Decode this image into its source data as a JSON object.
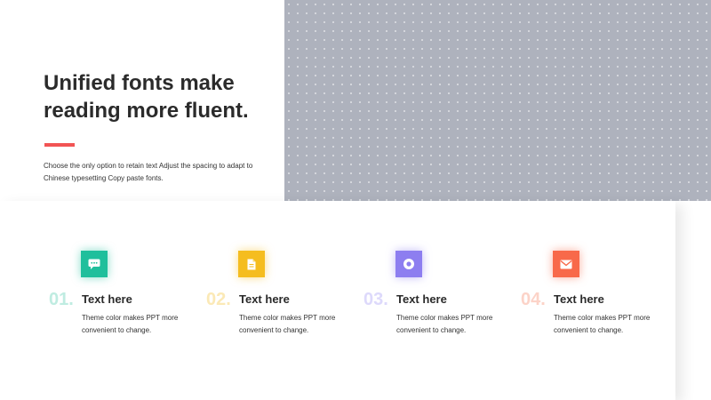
{
  "hero": {
    "title": "Unified fonts make\nreading more fluent.",
    "description": "Choose the only option to retain text Adjust the spacing to adapt to Chinese typesetting Copy paste fonts."
  },
  "features": [
    {
      "number": "01.",
      "title": "Text here",
      "description": "Theme color makes PPT more convenient to change.",
      "icon": "chat-bubble-icon",
      "color": "#1fbf9c"
    },
    {
      "number": "02.",
      "title": "Text here",
      "description": "Theme color makes PPT more convenient to change.",
      "icon": "document-icon",
      "color": "#f5bd1f"
    },
    {
      "number": "03.",
      "title": "Text here",
      "description": "Theme color makes PPT more convenient to change.",
      "icon": "ring-icon",
      "color": "#8d7ef0"
    },
    {
      "number": "04.",
      "title": "Text here",
      "description": "Theme color makes PPT more convenient to change.",
      "icon": "envelope-icon",
      "color": "#f8694a"
    }
  ],
  "colors": {
    "accent": "#f25454",
    "pattern_bg": "#aeb2bd"
  }
}
